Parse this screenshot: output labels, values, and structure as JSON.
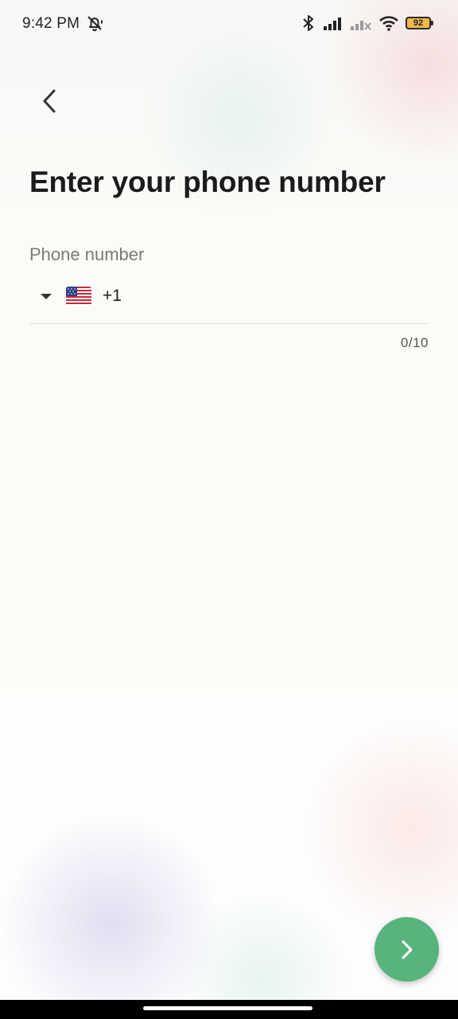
{
  "status_bar": {
    "time": "9:42 PM",
    "battery": "92",
    "icons": [
      "mute-icon",
      "bluetooth-icon",
      "signal-icon",
      "signal-no-service-icon",
      "wifi-icon",
      "battery-icon"
    ]
  },
  "header": {
    "back_icon": "chevron-left-icon",
    "title": "Enter your phone number"
  },
  "phone_field": {
    "label": "Phone number",
    "country_flag": "us-flag-icon",
    "dial_code": "+1",
    "value": "",
    "counter": "0/10"
  },
  "next_button": {
    "icon": "chevron-right-icon"
  },
  "colors": {
    "accent": "#56b47c",
    "title": "#1b1b1b",
    "label": "#7a7a7a"
  }
}
